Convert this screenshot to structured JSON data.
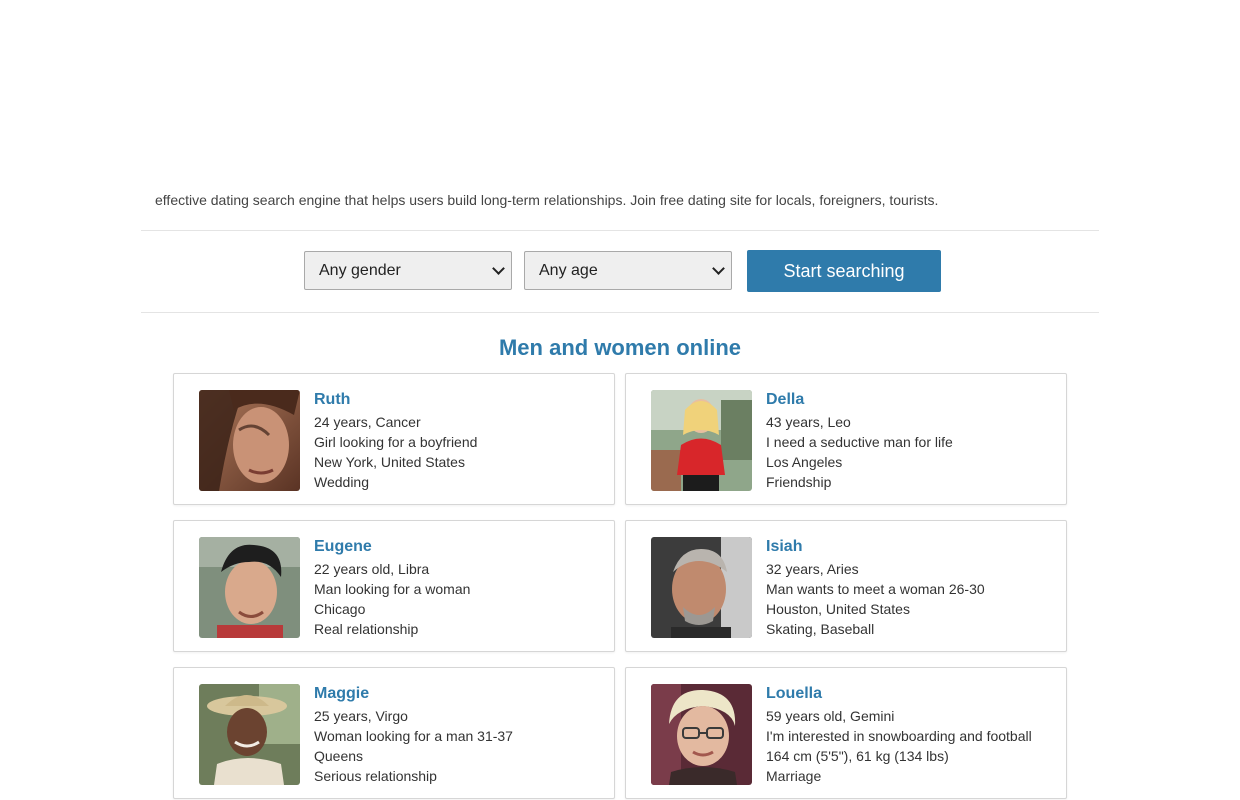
{
  "intro": {
    "text": "effective dating search engine that helps users build long-term relationships. Join free dating site for locals, foreigners, tourists."
  },
  "search": {
    "gender_selected": "Any gender",
    "age_selected": "Any age",
    "button_label": "Start searching"
  },
  "section": {
    "title": "Men and women online"
  },
  "profiles": [
    {
      "name": "Ruth",
      "age_sign": "24 years, Cancer",
      "looking": "Girl looking for a boyfriend",
      "location": "New York, United States",
      "goal": "Wedding"
    },
    {
      "name": "Della",
      "age_sign": "43 years, Leo",
      "looking": "I need a seductive man for life",
      "location": "Los Angeles",
      "goal": "Friendship"
    },
    {
      "name": "Eugene",
      "age_sign": "22 years old, Libra",
      "looking": "Man looking for a woman",
      "location": "Chicago",
      "goal": "Real relationship"
    },
    {
      "name": "Isiah",
      "age_sign": "32 years, Aries",
      "looking": "Man wants to meet a woman 26-30",
      "location": "Houston, United States",
      "goal": "Skating, Baseball"
    },
    {
      "name": "Maggie",
      "age_sign": "25 years, Virgo",
      "looking": "Woman looking for a man 31-37",
      "location": "Queens",
      "goal": "Serious relationship"
    },
    {
      "name": "Louella",
      "age_sign": "59 years old, Gemini",
      "looking": "I'm interested in snowboarding and football",
      "location": "164 cm (5'5\"), 61 kg (134 lbs)",
      "goal": "Marriage"
    }
  ],
  "colors": {
    "accent": "#2f7bab",
    "border": "#d6d6d6",
    "divider": "#e4e4e4"
  }
}
